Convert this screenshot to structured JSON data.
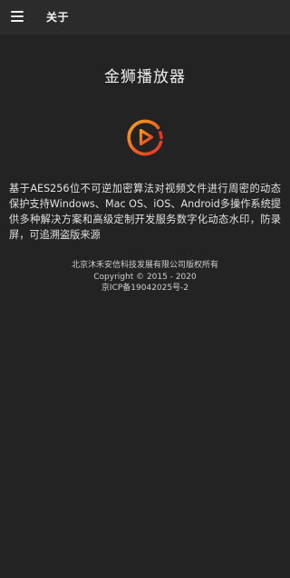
{
  "appbar": {
    "title": "关于",
    "menu_icon": "hamburger-menu-icon"
  },
  "main": {
    "app_name": "金狮播放器",
    "logo_icon": "play-circle-logo-icon",
    "description": "基于AES256位不可逆加密算法对视频文件进行周密的动态保护支持Windows、Mac OS、iOS、Android多操作系统提供多种解决方案和高级定制开发服务数字化动态水印，防录屏，可追溯盗版来源"
  },
  "footer": {
    "company": "北京沐禾安信科技发展有限公司版权所有",
    "copyright": "Copyright © 2015 - 2020",
    "icp": "京ICP备19042025号-2"
  },
  "colors": {
    "background": "#232323",
    "appbar": "#2b2b2b",
    "logo_orange": "#f58a1f",
    "logo_red": "#e8332a"
  }
}
